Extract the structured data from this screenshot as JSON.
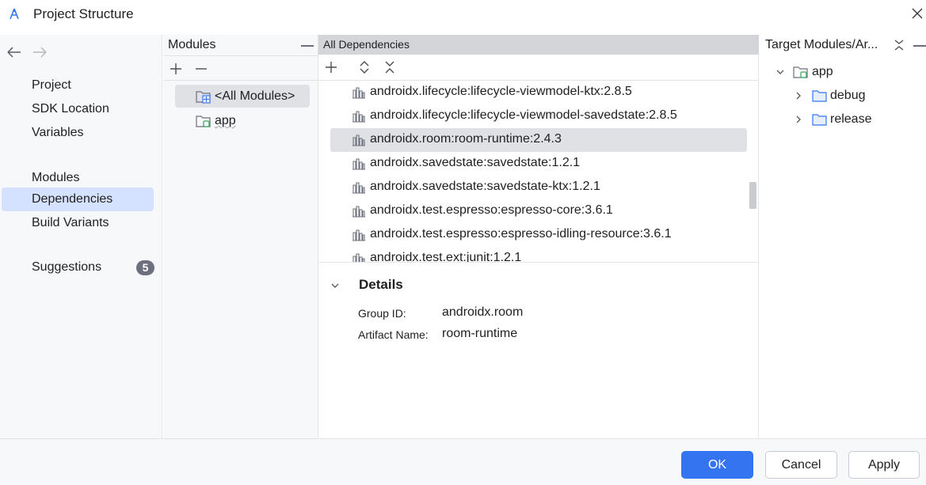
{
  "window": {
    "title": "Project Structure",
    "app_icon": "android-studio-icon",
    "close_icon": "close-icon"
  },
  "nav": {
    "back_icon": "arrow-left-icon",
    "forward_icon": "arrow-right-icon",
    "items": [
      {
        "label": "Project",
        "selected": false
      },
      {
        "label": "SDK Location",
        "selected": false
      },
      {
        "label": "Variables",
        "selected": false
      },
      {
        "label": "Modules",
        "selected": false
      },
      {
        "label": "Dependencies",
        "selected": true
      },
      {
        "label": "Build Variants",
        "selected": false
      },
      {
        "label": "Suggestions",
        "selected": false
      }
    ],
    "suggestions_count": "5"
  },
  "modules_panel": {
    "title": "Modules",
    "add_icon": "plus-icon",
    "remove_icon": "minus-icon",
    "items": [
      {
        "label": "<All Modules>",
        "icon": "all-modules-icon",
        "selected": true
      },
      {
        "label": "app",
        "icon": "module-folder-icon",
        "selected": false
      }
    ]
  },
  "dependencies_panel": {
    "title": "All Dependencies",
    "add_icon": "plus-icon",
    "expand_icon": "expand-all-icon",
    "collapse_icon": "collapse-all-icon",
    "items": [
      {
        "label": "androidx.lifecycle:lifecycle-viewmodel-ktx:2.8.5",
        "selected": false
      },
      {
        "label": "androidx.lifecycle:lifecycle-viewmodel-savedstate:2.8.5",
        "selected": false
      },
      {
        "label": "androidx.room:room-runtime:2.4.3",
        "selected": true
      },
      {
        "label": "androidx.savedstate:savedstate:1.2.1",
        "selected": false
      },
      {
        "label": "androidx.savedstate:savedstate-ktx:1.2.1",
        "selected": false
      },
      {
        "label": "androidx.test.espresso:espresso-core:3.6.1",
        "selected": false
      },
      {
        "label": "androidx.test.espresso:espresso-idling-resource:3.6.1",
        "selected": false
      },
      {
        "label": "androidx.test.ext:junit:1.2.1",
        "selected": false
      }
    ]
  },
  "details": {
    "title": "Details",
    "group_id_label": "Group ID:",
    "group_id_value": "androidx.room",
    "artifact_label": "Artifact Name:",
    "artifact_value": "room-runtime"
  },
  "targets_panel": {
    "title": "Target Modules/Ar...",
    "collapse_icon": "collapse-all-icon",
    "minimize_icon": "minus-icon",
    "tree": [
      {
        "label": "app",
        "expanded": true
      },
      {
        "label": "debug",
        "expanded": false
      },
      {
        "label": "release",
        "expanded": false
      }
    ]
  },
  "footer": {
    "ok_label": "OK",
    "cancel_label": "Cancel",
    "apply_label": "Apply"
  },
  "colors": {
    "accent": "#3574f0",
    "nav_selected": "#d4e2ff",
    "row_selected": "#dfe1e5",
    "header_bg": "#d4d5d9"
  }
}
